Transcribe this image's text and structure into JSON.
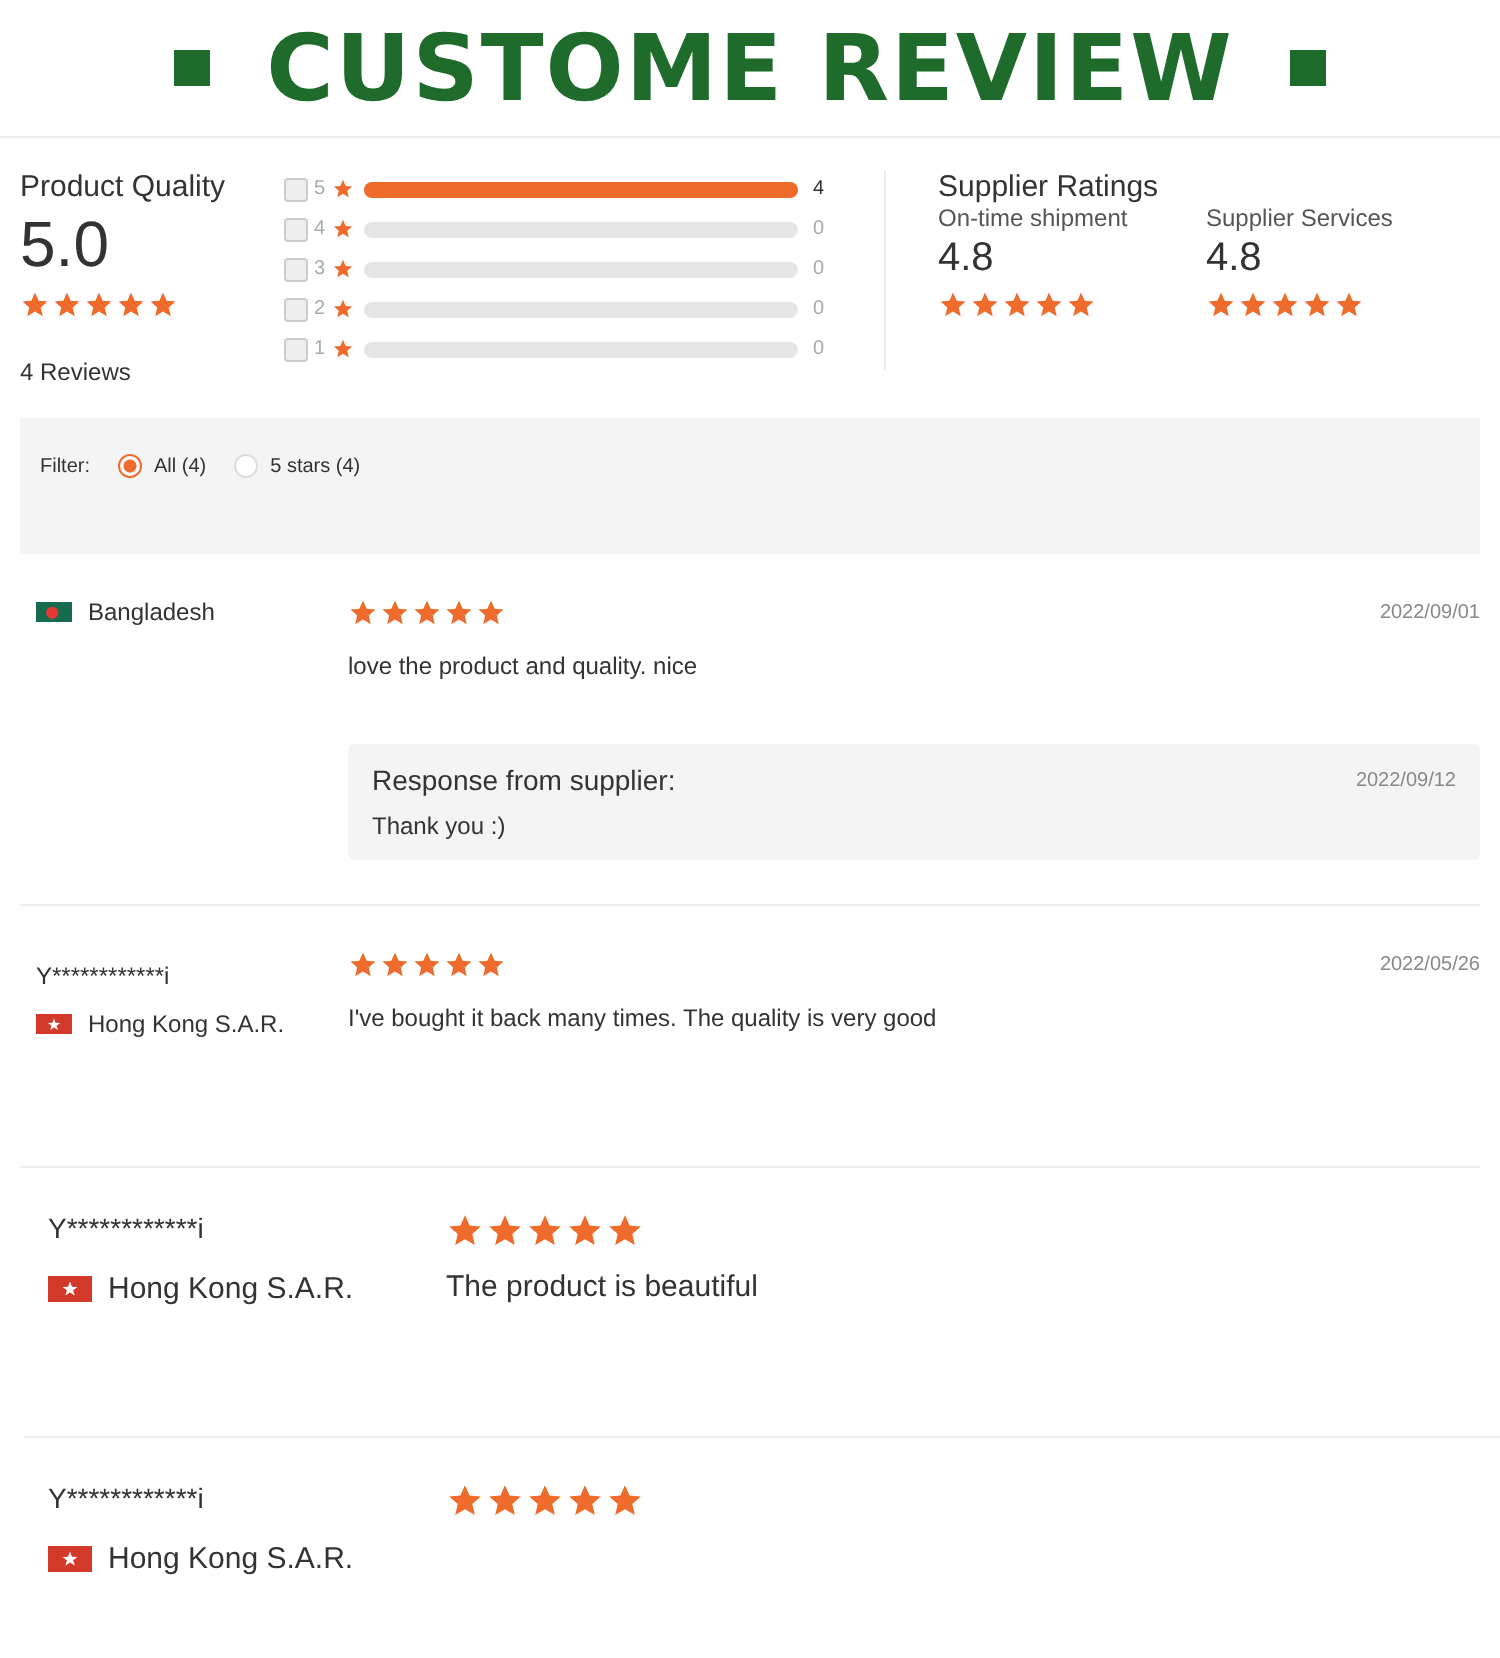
{
  "banner": {
    "title": "CUSTOME REVIEW"
  },
  "product_quality": {
    "label": "Product Quality",
    "score": "5.0",
    "stars": 5,
    "count": "4 Reviews"
  },
  "distribution": [
    {
      "label": "5",
      "checked": false,
      "level": 1,
      "count": "4"
    },
    {
      "label": "4",
      "checked": false,
      "count": "0"
    },
    {
      "label": "3",
      "checked": false,
      "count": "0"
    },
    {
      "label": "2",
      "checked": false,
      "count": "0"
    },
    {
      "label": "1",
      "checked": false,
      "count": "0"
    }
  ],
  "supplier_ratings": {
    "title": "Supplier Ratings",
    "items": [
      {
        "label": "On-time shipment",
        "score": "4.8",
        "stars": 5
      },
      {
        "label": "Supplier Services",
        "score": "4.8",
        "stars": 5
      }
    ]
  },
  "filter": {
    "label": "Filter:",
    "options": [
      {
        "label": "All (4)",
        "selected": true
      },
      {
        "label": "5 stars (4)",
        "selected": false
      }
    ]
  },
  "reviews": [
    {
      "kind": "standard",
      "flag": {
        "kind": "bangladesh"
      },
      "country": "Bangladesh",
      "stars": 5,
      "date": "2022/09/01",
      "text": "love the product and quality. nice",
      "response": {
        "title": "Response from supplier:",
        "date": "2022/09/12",
        "text": "Thank you :)"
      }
    },
    {
      "kind": "standard",
      "user": "Y************i",
      "flag": {
        "kind": "hongkong"
      },
      "country": "Hong Kong S.A.R.",
      "stars": 5,
      "date": "2022/05/26",
      "text": "I've bought it back many times. The quality is very good"
    },
    {
      "kind": "enlarged",
      "user": "Y************i",
      "flag": {
        "kind": "hongkong"
      },
      "country": "Hong Kong S.A.R.",
      "stars": 5,
      "text": "The product is beautiful"
    },
    {
      "kind": "enlarged",
      "user": "Y************i",
      "flag": {
        "kind": "hongkong"
      },
      "country": "Hong Kong S.A.R.",
      "stars": 5
    }
  ]
}
